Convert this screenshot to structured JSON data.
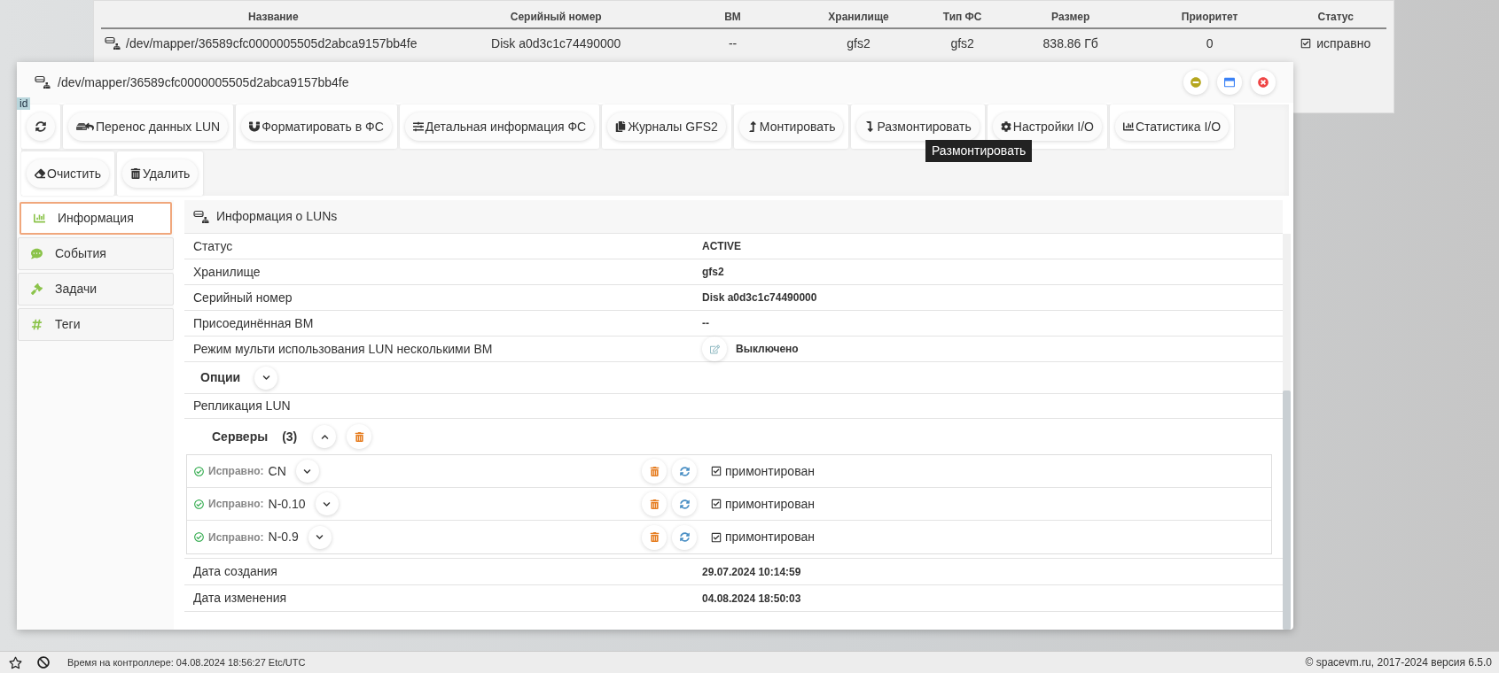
{
  "background_table": {
    "columns": [
      "Название",
      "Серийный номер",
      "ВМ",
      "Хранилище",
      "Тип ФС",
      "Размер",
      "Приоритет",
      "Статус"
    ],
    "rows": [
      {
        "cells": [
          "/dev/mapper/36589cfc0000005505d2abca9157bb4fe",
          "Disk a0d3c1c74490000",
          "--",
          "gfs2",
          "gfs2",
          "838.86 Гб",
          "0",
          "исправно"
        ],
        "status_checked": true
      }
    ]
  },
  "window": {
    "title": "/dev/mapper/36589cfc0000005505d2abca9157bb4fe",
    "badge": "id"
  },
  "toolbar": [
    {
      "kind": "refresh"
    },
    {
      "kind": "migrate",
      "label": "Перенос данных LUN"
    },
    {
      "kind": "format",
      "label": "Форматировать в ФС"
    },
    {
      "kind": "details",
      "label": "Детальная информация ФС"
    },
    {
      "kind": "journals",
      "label": "Журналы GFS2"
    },
    {
      "kind": "mount",
      "label": "Монтировать"
    },
    {
      "kind": "unmount",
      "label": "Размонтировать"
    },
    {
      "kind": "settings",
      "label": "Настройки I/O"
    },
    {
      "kind": "stats",
      "label": "Статистика I/O"
    },
    {
      "kind": "clear",
      "label": "Очистить"
    },
    {
      "kind": "delete",
      "label": "Удалить"
    }
  ],
  "tooltip": "Размонтировать",
  "sidebar": {
    "items": [
      {
        "kind": "info",
        "label": "Информация",
        "selected": true
      },
      {
        "kind": "events",
        "label": "События",
        "selected": false
      },
      {
        "kind": "tasks",
        "label": "Задачи",
        "selected": false
      },
      {
        "kind": "tags",
        "label": "Теги",
        "selected": false
      }
    ]
  },
  "content": {
    "title": "Информация о LUNs",
    "rows": [
      {
        "label": "Статус",
        "value": "ACTIVE"
      },
      {
        "label": "Хранилище",
        "value": "gfs2"
      },
      {
        "label": "Серийный номер",
        "value": "Disk a0d3c1c74490000"
      },
      {
        "label": "Присоединённая ВМ",
        "value": "--"
      },
      {
        "label": "Режим мульти использования LUN несколькими ВМ",
        "value": "Выключено",
        "editable": true
      }
    ],
    "options": {
      "title": "Опции",
      "expanded": false
    },
    "replication": "Репликация LUN",
    "servers": {
      "title": "Серверы",
      "count": "(3)",
      "expanded": true,
      "items": [
        {
          "status": "Исправно:",
          "name": "CN",
          "expanded": false,
          "mount": "примонтирован",
          "mounted": true
        },
        {
          "status": "Исправно:",
          "name": "N-0.10",
          "expanded": false,
          "mount": "примонтирован",
          "mounted": true
        },
        {
          "status": "Исправно:",
          "name": "N-0.9",
          "expanded": false,
          "mount": "примонтирован",
          "mounted": true
        }
      ]
    },
    "dates": [
      {
        "label": "Дата создания",
        "value": "29.07.2024 10:14:59"
      },
      {
        "label": "Дата изменения",
        "value": "04.08.2024 18:50:03"
      }
    ]
  },
  "status_bar": {
    "time": "Время на контроллере: 04.08.2024 18:56:27 Etc/UTC",
    "copyright": "© spacevm.ru, 2017-2024 версия 6.5.0"
  }
}
